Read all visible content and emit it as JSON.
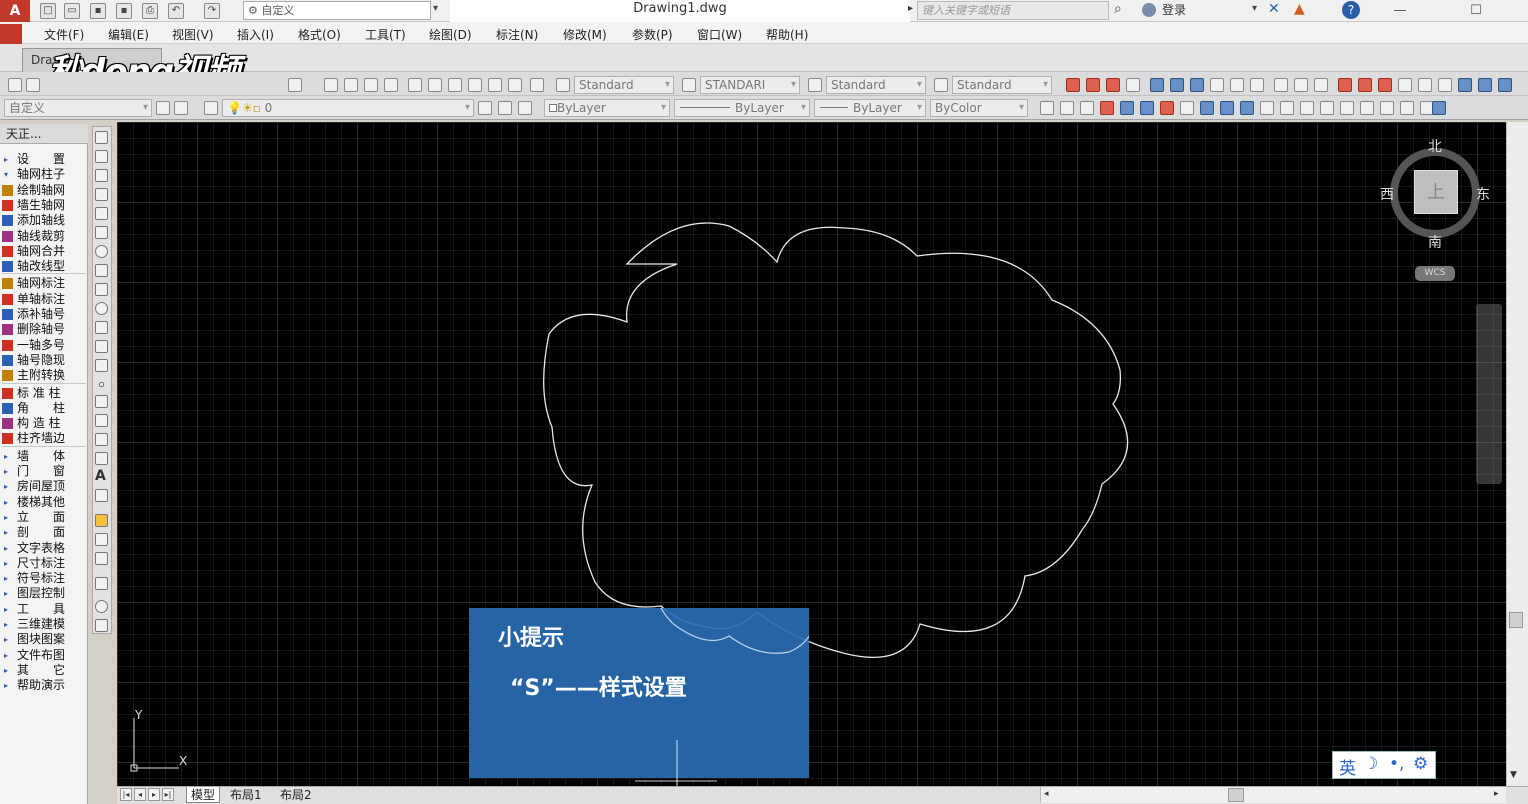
{
  "app": {
    "logo_text": "A",
    "workspace": "自定义",
    "document_title": "Drawing1.dwg",
    "search_placeholder": "键入关键字或短语",
    "login_label": "登录",
    "help_label": "?"
  },
  "menu": [
    "文件(F)",
    "编辑(E)",
    "视图(V)",
    "插入(I)",
    "格式(O)",
    "工具(T)",
    "绘图(D)",
    "标注(N)",
    "修改(M)",
    "参数(P)",
    "窗口(W)",
    "帮助(H)"
  ],
  "file_tab": "Drav",
  "watermark": "秒dong视频",
  "toolbar1": {
    "text_style": "Standard",
    "dim_style": "STANDARI",
    "table_style": "Standard",
    "multileader_style": "Standard"
  },
  "toolbar2": {
    "workspace_combo": "自定义",
    "layer": "0",
    "color": "ByLayer",
    "linetype": "ByLayer",
    "lineweight": "ByLayer",
    "plotstyle": "ByColor"
  },
  "palette": {
    "header": "天正...",
    "items": [
      {
        "label": "设　　置",
        "kind": "arrow"
      },
      {
        "label": "轴网柱子",
        "kind": "open"
      },
      {
        "label": "绘制轴网",
        "kind": "icon"
      },
      {
        "label": "墙生轴网",
        "kind": "icon"
      },
      {
        "label": "添加轴线",
        "kind": "icon"
      },
      {
        "label": "轴线裁剪",
        "kind": "icon"
      },
      {
        "label": "轴网合并",
        "kind": "icon"
      },
      {
        "label": "轴改线型",
        "kind": "icon"
      },
      {
        "label": "轴网标注",
        "kind": "icon"
      },
      {
        "label": "单轴标注",
        "kind": "icon"
      },
      {
        "label": "添补轴号",
        "kind": "icon"
      },
      {
        "label": "删除轴号",
        "kind": "icon"
      },
      {
        "label": "一轴多号",
        "kind": "icon"
      },
      {
        "label": "轴号隐现",
        "kind": "icon"
      },
      {
        "label": "主附转换",
        "kind": "icon"
      },
      {
        "label": "标 准 柱",
        "kind": "icon"
      },
      {
        "label": "角　　柱",
        "kind": "icon"
      },
      {
        "label": "构 造 柱",
        "kind": "icon"
      },
      {
        "label": "柱齐墙边",
        "kind": "icon"
      },
      {
        "label": "墙　　体",
        "kind": "arrow"
      },
      {
        "label": "门　　窗",
        "kind": "arrow"
      },
      {
        "label": "房间屋顶",
        "kind": "arrow"
      },
      {
        "label": "楼梯其他",
        "kind": "arrow"
      },
      {
        "label": "立　　面",
        "kind": "arrow"
      },
      {
        "label": "剖　　面",
        "kind": "arrow"
      },
      {
        "label": "文字表格",
        "kind": "arrow"
      },
      {
        "label": "尺寸标注",
        "kind": "arrow"
      },
      {
        "label": "符号标注",
        "kind": "arrow"
      },
      {
        "label": "图层控制",
        "kind": "arrow"
      },
      {
        "label": "工　　具",
        "kind": "arrow"
      },
      {
        "label": "三维建模",
        "kind": "arrow"
      },
      {
        "label": "图块图案",
        "kind": "arrow"
      },
      {
        "label": "文件布图",
        "kind": "arrow"
      },
      {
        "label": "其　　它",
        "kind": "arrow"
      },
      {
        "label": "帮助演示",
        "kind": "arrow"
      }
    ]
  },
  "viewcube": {
    "north": "北",
    "south": "南",
    "east": "东",
    "west": "西",
    "top": "上",
    "wcs": "WCS"
  },
  "tip": {
    "title": "小提示",
    "body": "“S”——样式设置"
  },
  "ime": {
    "lang": "英",
    "moon": "☽",
    "punct": "•,",
    "settings": "⚙"
  },
  "ucs": {
    "x": "X",
    "y": "Y"
  },
  "layout_tabs": [
    "模型",
    "布局1",
    "布局2"
  ],
  "colors": {
    "canvas_bg": "#000000",
    "tip_bg": "#2a6cb2",
    "cloud_stroke": "#e8e8e8"
  }
}
